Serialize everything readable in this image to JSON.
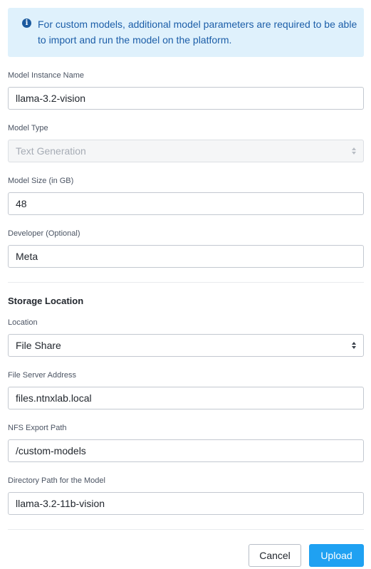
{
  "banner": {
    "icon": "info-icon",
    "text": "For custom models, additional model parameters are required to be able to import and run the model on the platform."
  },
  "fields": {
    "instance_name": {
      "label": "Model Instance Name",
      "value": "llama-3.2-vision"
    },
    "model_type": {
      "label": "Model Type",
      "value": "Text Generation",
      "disabled": true
    },
    "model_size": {
      "label": "Model Size (in GB)",
      "value": "48"
    },
    "developer": {
      "label": "Developer (Optional)",
      "value": "Meta"
    }
  },
  "storage": {
    "title": "Storage Location",
    "location": {
      "label": "Location",
      "value": "File Share"
    },
    "file_server": {
      "label": "File Server Address",
      "value": "files.ntnxlab.local"
    },
    "nfs_path": {
      "label": "NFS Export Path",
      "value": "/custom-models"
    },
    "directory_path": {
      "label": "Directory Path for the Model",
      "value": "llama-3.2-11b-vision"
    }
  },
  "footer": {
    "cancel_label": "Cancel",
    "upload_label": "Upload",
    "primary_color": "#1fa1f2"
  }
}
